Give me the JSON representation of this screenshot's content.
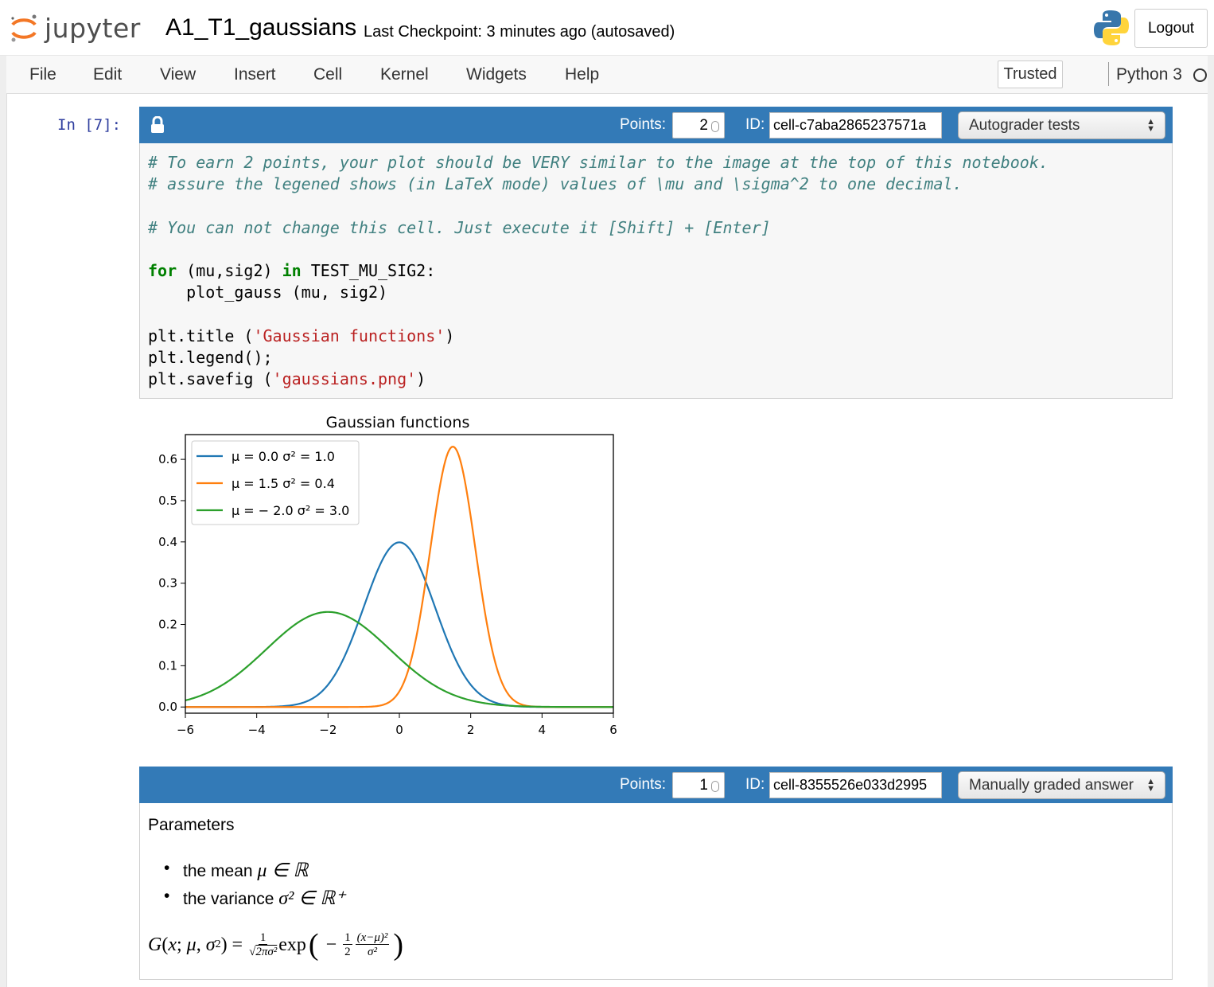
{
  "header": {
    "logo_text": "jupyter",
    "notebook_name": "A1_T1_gaussians",
    "checkpoint": "Last Checkpoint: 3 minutes ago (autosaved)",
    "logout_label": "Logout"
  },
  "menubar": {
    "items": [
      "File",
      "Edit",
      "View",
      "Insert",
      "Cell",
      "Kernel",
      "Widgets",
      "Help"
    ],
    "trusted_label": "Trusted",
    "kernel_name": "Python 3"
  },
  "cell1": {
    "prompt": "In [7]:",
    "points_label": "Points:",
    "points_value": "2",
    "id_label": "ID:",
    "cell_id": "cell-c7aba2865237571a",
    "cell_type": "Autograder tests"
  },
  "chart_data": {
    "type": "line",
    "title": "Gaussian functions",
    "xlim": [
      -6,
      6
    ],
    "ylim": [
      -0.015,
      0.66
    ],
    "xticks": [
      "−6",
      "−4",
      "−2",
      "0",
      "2",
      "4",
      "6"
    ],
    "xtick_values": [
      -6,
      -4,
      -2,
      0,
      2,
      4,
      6
    ],
    "yticks": [
      "0.0",
      "0.1",
      "0.2",
      "0.3",
      "0.4",
      "0.5",
      "0.6"
    ],
    "ytick_values": [
      0,
      0.1,
      0.2,
      0.3,
      0.4,
      0.5,
      0.6
    ],
    "legend_position": "top-left",
    "series": [
      {
        "name": "μ = 0.0  σ² = 1.0",
        "mu": 0.0,
        "sigma2": 1.0,
        "color": "#1f77b4"
      },
      {
        "name": "μ = 1.5  σ² = 0.4",
        "mu": 1.5,
        "sigma2": 0.4,
        "color": "#ff7f0e"
      },
      {
        "name": "μ = − 2.0  σ² = 3.0",
        "mu": -2.0,
        "sigma2": 3.0,
        "color": "#2ca02c"
      }
    ]
  },
  "cell2": {
    "points_label": "Points:",
    "points_value": "1",
    "id_label": "ID:",
    "cell_id": "cell-8355526e033d2995",
    "cell_type": "Manually graded answer",
    "heading": "Parameters",
    "bullet1_text": "the mean ",
    "bullet1_math": "μ ∈ ℝ",
    "bullet2_text": "the variance ",
    "bullet2_math": "σ² ∈ ℝ⁺"
  },
  "colors": {
    "cell_header": "#337ab7",
    "prompt_in": "#303f9f"
  },
  "icons": {
    "lock": "lock-icon",
    "python_logo": "python-logo-icon"
  }
}
